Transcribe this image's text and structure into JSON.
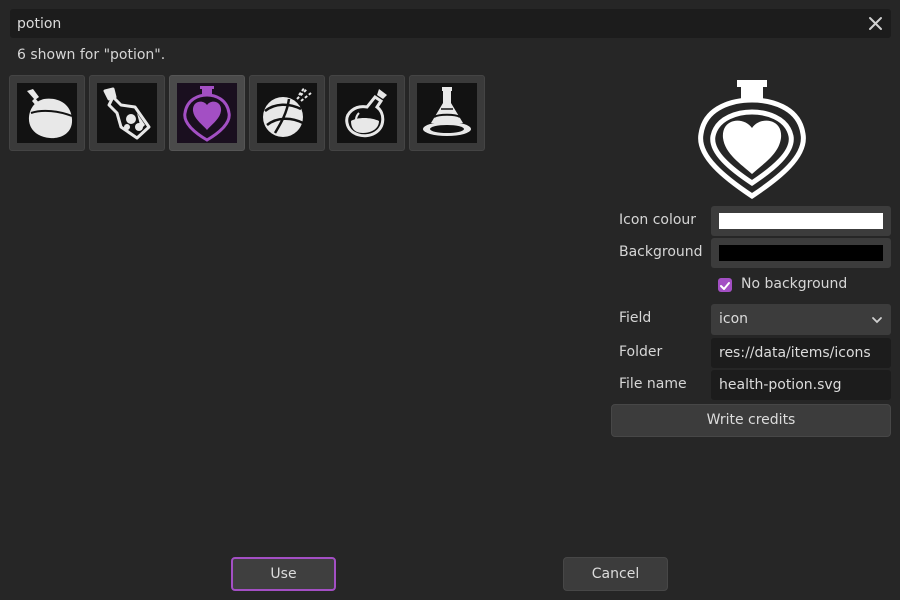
{
  "search": {
    "value": "potion",
    "clear_icon": "close-icon"
  },
  "results": {
    "count_text": "6 shown for \"potion\"."
  },
  "icons": [
    {
      "name": "round-potion",
      "selected": false
    },
    {
      "name": "tilted-potion",
      "selected": false
    },
    {
      "name": "health-potion",
      "selected": true,
      "color": "#a34fc4"
    },
    {
      "name": "bound-potion",
      "selected": false
    },
    {
      "name": "flask-potion",
      "selected": false
    },
    {
      "name": "standing-potion",
      "selected": false
    }
  ],
  "properties": {
    "icon_colour_label": "Icon colour",
    "icon_colour_value": "#ffffff",
    "background_label": "Background",
    "background_value": "#000000",
    "no_background_label": "No background",
    "no_background_checked": true,
    "field_label": "Field",
    "field_value": "icon",
    "folder_label": "Folder",
    "folder_value": "res://data/items/icons",
    "file_name_label": "File name",
    "file_name_value": "health-potion.svg",
    "write_credits_label": "Write credits"
  },
  "footer": {
    "use_label": "Use",
    "cancel_label": "Cancel"
  },
  "colors": {
    "accent": "#a34fc4"
  }
}
